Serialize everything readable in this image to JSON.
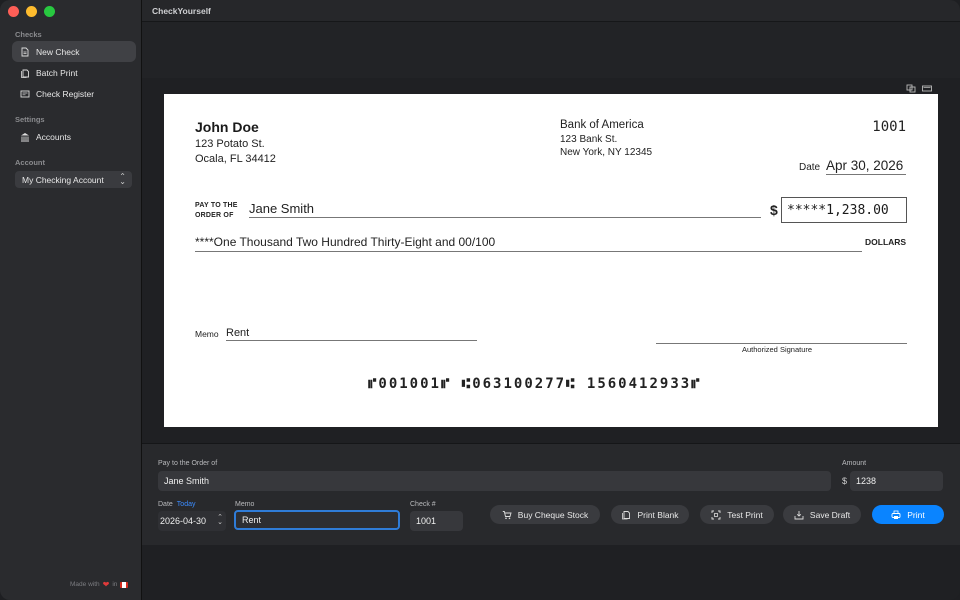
{
  "app": {
    "title": "CheckYourself"
  },
  "sidebar": {
    "checks_section": "Checks",
    "settings_section": "Settings",
    "account_section": "Account",
    "items": [
      {
        "label": "New Check",
        "icon": "document-icon"
      },
      {
        "label": "Batch Print",
        "icon": "documents-stack-icon"
      },
      {
        "label": "Check Register",
        "icon": "register-icon"
      },
      {
        "label": "Accounts",
        "icon": "building-columns-icon"
      }
    ],
    "account_selected": "My Checking Account",
    "footer_made": "Made with",
    "footer_in": "in"
  },
  "check": {
    "payer_name": "John Doe",
    "payer_addr1": "123 Potato St.",
    "payer_addr2": "Ocala, FL 34412",
    "bank_name": "Bank of America",
    "bank_addr1": "123 Bank St.",
    "bank_addr2": "New York, NY 12345",
    "number": "1001",
    "date_label": "Date",
    "date": "Apr 30, 2026",
    "payto_line1": "PAY TO THE",
    "payto_line2": "ORDER OF",
    "payee": "Jane Smith",
    "dollar_sign": "$",
    "amount": "*****1,238.00",
    "amount_words": "****One Thousand Two Hundred Thirty-Eight and 00/100",
    "dollars_label": "DOLLARS",
    "memo_label": "Memo",
    "memo": "Rent",
    "signature_label": "Authorized Signature",
    "micr": "⑈001001⑈ ⑆063100277⑆ 1560412933⑈"
  },
  "form": {
    "payto_label": "Pay to the Order of",
    "payto_value": "Jane Smith",
    "amount_label": "Amount",
    "amount_prefix": "$",
    "amount_value": "1238",
    "date_label": "Date",
    "today_label": "Today",
    "date_value": "2026-04-30",
    "memo_label": "Memo",
    "memo_value": "Rent",
    "checkno_label": "Check #",
    "checkno_value": "1001"
  },
  "buttons": {
    "buy": "Buy Cheque Stock",
    "print_blank": "Print Blank",
    "test_print": "Test Print",
    "save_draft": "Save Draft",
    "print": "Print"
  },
  "colors": {
    "accent": "#0a84ff",
    "focus": "#2f7cd8"
  }
}
